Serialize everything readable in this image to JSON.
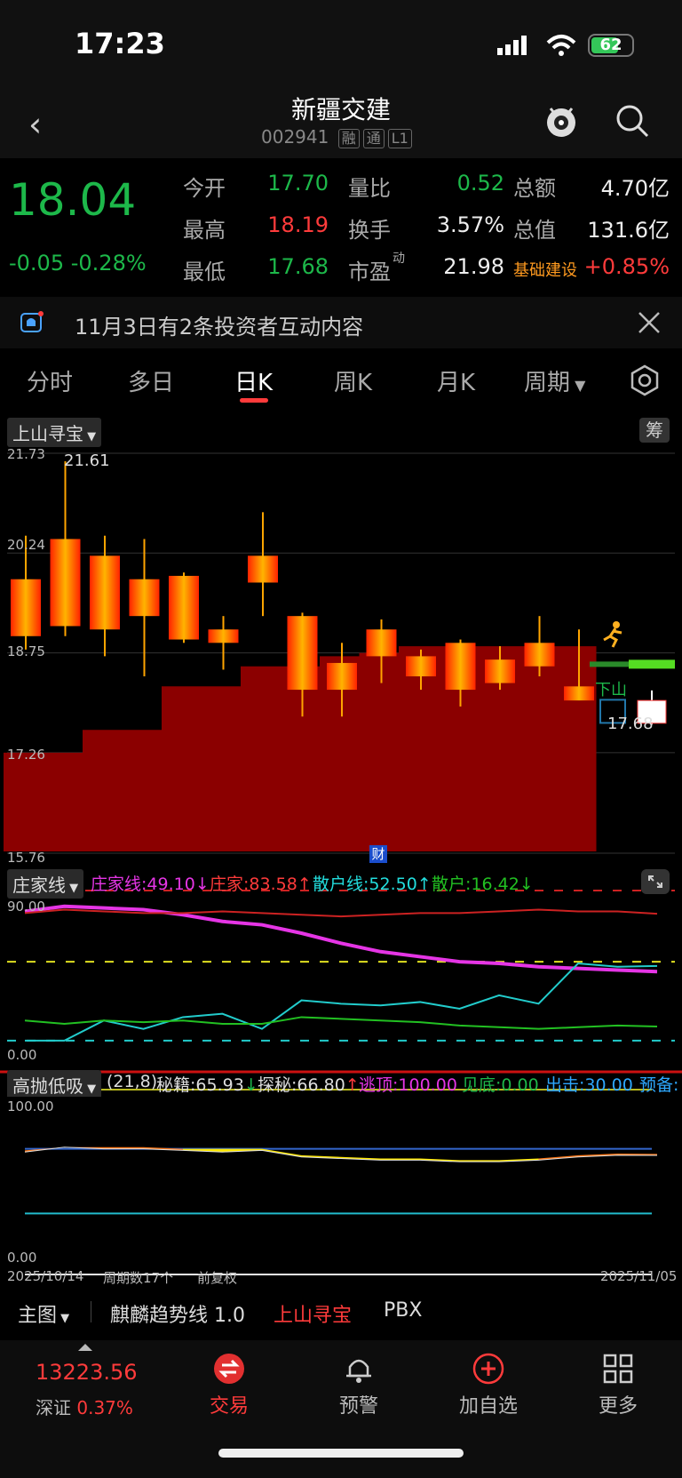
{
  "status_bar": {
    "time": "17:23",
    "battery": "62"
  },
  "header": {
    "title": "新疆交建",
    "code": "002941",
    "tags": [
      "融",
      "通",
      "L1"
    ]
  },
  "quote": {
    "price": "18.04",
    "change": "-0.05",
    "change_pct": "-0.28%",
    "rows": [
      [
        {
          "label": "今开",
          "value": "17.70",
          "color": "green"
        },
        {
          "label": "量比",
          "value": "0.52",
          "color": "green"
        },
        {
          "label": "总额",
          "value": "4.70亿",
          "color": "white"
        }
      ],
      [
        {
          "label": "最高",
          "value": "18.19",
          "color": "red"
        },
        {
          "label": "换手",
          "value": "3.57%",
          "color": "white"
        },
        {
          "label": "总值",
          "value": "131.6亿",
          "color": "white"
        }
      ],
      [
        {
          "label": "最低",
          "value": "17.68",
          "color": "green"
        },
        {
          "label": "市盈",
          "label_sup": "动",
          "value": "21.98",
          "color": "white"
        },
        {
          "label": "基础建设",
          "value": "+0.85%",
          "color": "red"
        }
      ]
    ]
  },
  "notice": {
    "text": "11月3日有2条投资者互动内容"
  },
  "tabs": [
    "分时",
    "多日",
    "日K",
    "周K",
    "月K",
    "周期"
  ],
  "active_tab": "日K",
  "main_chart": {
    "indicator": "上山寻宝",
    "corner_badge": "筹",
    "y_ticks": [
      "21.73",
      "20.24",
      "18.75",
      "17.26",
      "15.76"
    ],
    "high_label": "21.61",
    "low_label": "17.68",
    "down_label": "下山",
    "cai_label": "财"
  },
  "chart_data": [
    {
      "type": "candlestick",
      "title": "上山寻宝",
      "ylim": [
        15.76,
        21.73
      ],
      "candles": [
        {
          "o": 19.0,
          "h": 20.5,
          "l": 18.8,
          "c": 19.85
        },
        {
          "o": 19.15,
          "h": 21.61,
          "l": 19.0,
          "c": 20.45
        },
        {
          "o": 20.2,
          "h": 20.5,
          "l": 18.7,
          "c": 19.1
        },
        {
          "o": 19.85,
          "h": 20.45,
          "l": 18.4,
          "c": 19.3
        },
        {
          "o": 19.9,
          "h": 19.95,
          "l": 18.9,
          "c": 18.95
        },
        {
          "o": 19.1,
          "h": 19.3,
          "l": 18.5,
          "c": 18.9
        },
        {
          "o": 20.2,
          "h": 20.85,
          "l": 19.3,
          "c": 19.8
        },
        {
          "o": 19.3,
          "h": 19.35,
          "l": 17.8,
          "c": 18.2
        },
        {
          "o": 18.6,
          "h": 18.9,
          "l": 17.8,
          "c": 18.2
        },
        {
          "o": 19.1,
          "h": 19.25,
          "l": 18.3,
          "c": 18.7
        },
        {
          "o": 18.7,
          "h": 18.8,
          "l": 18.2,
          "c": 18.4
        },
        {
          "o": 18.9,
          "h": 18.95,
          "l": 17.95,
          "c": 18.2
        },
        {
          "o": 18.65,
          "h": 18.85,
          "l": 18.2,
          "c": 18.3
        },
        {
          "o": 18.9,
          "h": 19.3,
          "l": 18.4,
          "c": 18.55
        },
        {
          "o": 18.25,
          "h": 19.1,
          "l": 18.05,
          "c": 18.04
        }
      ],
      "last_candle": {
        "o": 17.7,
        "h": 18.19,
        "l": 17.68,
        "c": 18.04
      },
      "support_steps": [
        17.26,
        17.26,
        17.6,
        17.6,
        18.25,
        18.25,
        18.55,
        18.55,
        18.7,
        18.75,
        18.85,
        18.85,
        18.85,
        18.85,
        18.85
      ]
    },
    {
      "type": "line",
      "title": "庄家线",
      "ylim": [
        0,
        90
      ],
      "series": [
        {
          "name": "庄家线",
          "value": "49.10",
          "color": "#e535e5",
          "values": [
            85,
            88,
            87,
            86,
            83,
            79,
            77,
            72,
            66,
            61,
            58,
            55,
            54,
            52,
            51,
            50,
            49.1
          ]
        },
        {
          "name": "庄家",
          "value": "83.58",
          "color": "#cc2222",
          "values": [
            84,
            86,
            85,
            84,
            84,
            85,
            84,
            83,
            82,
            83,
            84,
            84,
            85,
            86,
            85,
            85,
            83.58
          ]
        },
        {
          "name": "散户线",
          "value": "52.50",
          "color": "#22cccc",
          "values": [
            8,
            8,
            20,
            15,
            22,
            24,
            15,
            32,
            30,
            29,
            31,
            27,
            35,
            30,
            54,
            52,
            52.5
          ]
        },
        {
          "name": "散户",
          "value": "16.42",
          "color": "#22c022",
          "values": [
            20,
            18,
            20,
            19,
            20,
            18,
            18,
            22,
            21,
            20,
            19,
            17,
            16,
            15,
            16,
            17,
            16.42
          ]
        }
      ]
    },
    {
      "type": "line",
      "title": "高抛低吸",
      "ylim": [
        0,
        100
      ],
      "series": [
        {
          "name": "秘籍",
          "value": "65.93",
          "values": [
            68,
            71,
            70,
            70,
            69,
            68,
            69,
            65,
            64,
            63,
            63,
            62,
            62,
            63,
            65,
            66,
            65.93
          ]
        },
        {
          "name": "探秘",
          "value": "66.80",
          "values": [
            69,
            71,
            71,
            71,
            70,
            70,
            70,
            66,
            65,
            64,
            64,
            63,
            63,
            64,
            66,
            67,
            66.8
          ]
        }
      ],
      "extras": [
        {
          "name": "逃顶",
          "value": "100.00"
        },
        {
          "name": "见底",
          "value": "0.00"
        },
        {
          "name": "出击",
          "value": "30.00"
        },
        {
          "name": "预备",
          "value": ""
        }
      ],
      "params": "(21,8)"
    }
  ],
  "sub1": {
    "indicator": "庄家线",
    "y_top": "90.00",
    "y_bottom": "0.00"
  },
  "sub2": {
    "indicator": "高抛低吸",
    "y_top": "100.00",
    "y_bottom": "0.00",
    "params": "(21,8)"
  },
  "footer_axis": {
    "start_date": "2025/10/14",
    "period_count": "周期数17个",
    "adjust": "前复权",
    "end_date": "2025/11/05"
  },
  "bottom_tabs": [
    "主图",
    "麒麟趋势线 1.0",
    "上山寻宝",
    "PBX"
  ],
  "tabbar": {
    "index_value": "13223.56",
    "index_name": "深证",
    "index_pct": "0.37%",
    "items": [
      "交易",
      "预警",
      "加自选",
      "更多"
    ]
  }
}
